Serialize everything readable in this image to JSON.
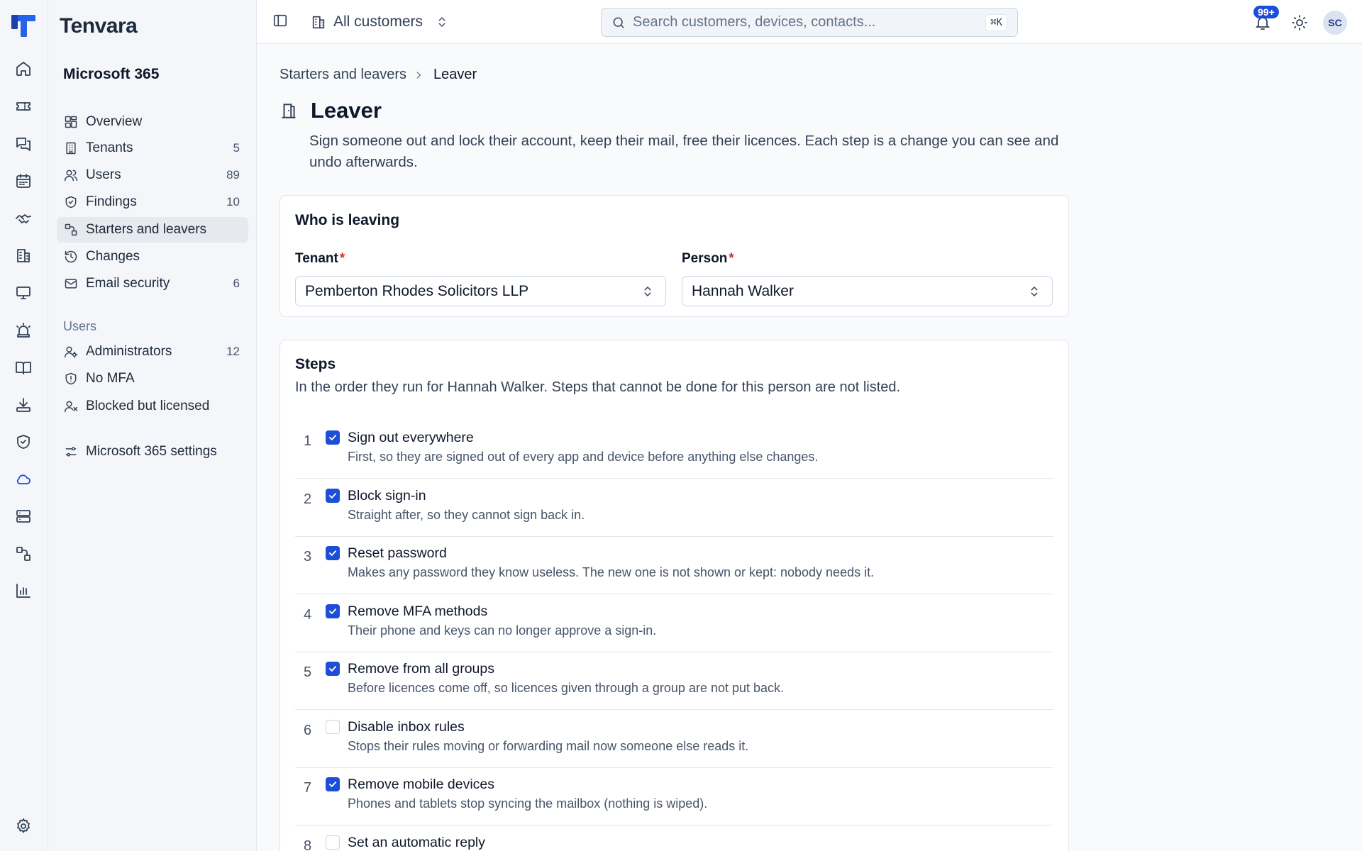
{
  "app": {
    "brand": "Tenvara"
  },
  "rail": {
    "items": [
      "home-icon",
      "ticket-icon",
      "chat-icon",
      "calendar-icon",
      "handshake-icon",
      "building-icon",
      "monitor-icon",
      "siren-icon",
      "book-icon",
      "download-icon",
      "shield-icon",
      "cloud-icon",
      "server-icon",
      "workflow-icon",
      "bar-chart-icon"
    ],
    "settings": "gear-icon"
  },
  "sidebar": {
    "section_title": "Microsoft 365",
    "items": [
      {
        "label": "Overview",
        "count": "",
        "icon": "dashboard-icon"
      },
      {
        "label": "Tenants",
        "count": "5",
        "icon": "building-icon"
      },
      {
        "label": "Users",
        "count": "89",
        "icon": "users-icon"
      },
      {
        "label": "Findings",
        "count": "10",
        "icon": "shield-check-icon"
      },
      {
        "label": "Starters and leavers",
        "count": "",
        "icon": "workflow-icon"
      },
      {
        "label": "Changes",
        "count": "",
        "icon": "history-icon"
      },
      {
        "label": "Email security",
        "count": "6",
        "icon": "mail-icon"
      }
    ],
    "group_label": "Users",
    "group_items": [
      {
        "label": "Administrators",
        "count": "12",
        "icon": "user-cog-icon"
      },
      {
        "label": "No MFA",
        "count": "",
        "icon": "shield-alert-icon"
      },
      {
        "label": "Blocked but licensed",
        "count": "",
        "icon": "user-x-icon"
      }
    ],
    "settings_label": "Microsoft 365 settings"
  },
  "topbar": {
    "customer_switch": "All customers",
    "search_placeholder": "Search customers, devices, contacts...",
    "search_shortcut": "⌘K",
    "notification_badge": "99+",
    "avatar_initials": "SC"
  },
  "breadcrumb": {
    "parent": "Starters and leavers",
    "current": "Leaver"
  },
  "page": {
    "title": "Leaver",
    "description": "Sign someone out and lock their account, keep their mail, free their licences. Each step is a change you can see and undo afterwards."
  },
  "who_card": {
    "title": "Who is leaving",
    "tenant_label": "Tenant",
    "tenant_value": "Pemberton Rhodes Solicitors LLP",
    "person_label": "Person",
    "person_value": "Hannah Walker",
    "required_mark": "*"
  },
  "steps_card": {
    "title": "Steps",
    "subtitle": "In the order they run for Hannah Walker. Steps that cannot be done for this person are not listed.",
    "steps": [
      {
        "num": "1",
        "title": "Sign out everywhere",
        "desc": "First, so they are signed out of every app and device before anything else changes.",
        "checked": true
      },
      {
        "num": "2",
        "title": "Block sign-in",
        "desc": "Straight after, so they cannot sign back in.",
        "checked": true
      },
      {
        "num": "3",
        "title": "Reset password",
        "desc": "Makes any password they know useless. The new one is not shown or kept: nobody needs it.",
        "checked": true
      },
      {
        "num": "4",
        "title": "Remove MFA methods",
        "desc": "Their phone and keys can no longer approve a sign-in.",
        "checked": true
      },
      {
        "num": "5",
        "title": "Remove from all groups",
        "desc": "Before licences come off, so licences given through a group are not put back.",
        "checked": true
      },
      {
        "num": "6",
        "title": "Disable inbox rules",
        "desc": "Stops their rules moving or forwarding mail now someone else reads it.",
        "checked": false
      },
      {
        "num": "7",
        "title": "Remove mobile devices",
        "desc": "Phones and tablets stop syncing the mailbox (nothing is wiped).",
        "checked": true
      },
      {
        "num": "8",
        "title": "Set an automatic reply",
        "desc": "",
        "checked": false
      }
    ]
  },
  "colors": {
    "accent": "#1d4ed8",
    "required": "#dc2626"
  }
}
